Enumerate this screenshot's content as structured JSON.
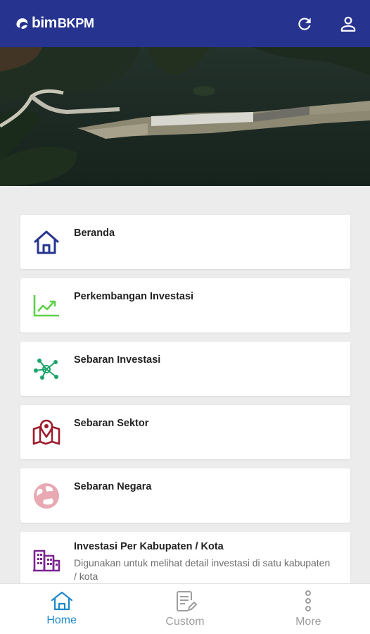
{
  "app": {
    "logo_bim": "bim",
    "logo_bkpm": "BKPM",
    "refresh_icon": "refresh-icon",
    "account_icon": "account-icon",
    "header_color": "#26348f"
  },
  "banner": {
    "image": "aerial-view-port-construction",
    "slide_count": 6,
    "active_slide": 2
  },
  "menu": {
    "items": [
      {
        "title": "Beranda",
        "icon": "home-icon",
        "icon_color": "#26348f"
      },
      {
        "title": "Perkembangan Investasi",
        "icon": "trending-chart-icon",
        "icon_color": "#5fd14a"
      },
      {
        "title": "Sebaran Investasi",
        "icon": "network-nodes-icon",
        "icon_color": "#1ba46a"
      },
      {
        "title": "Sebaran Sektor",
        "icon": "map-pin-icon",
        "icon_color": "#9c1c2a"
      },
      {
        "title": "Sebaran Negara",
        "icon": "globe-icon",
        "icon_color": "#e8a9b2"
      },
      {
        "title": "Investasi Per Kabupaten / Kota",
        "description": "Digunakan untuk melihat detail investasi di satu kabupaten / kota",
        "icon": "city-buildings-icon",
        "icon_color": "#7b2590"
      }
    ]
  },
  "bottom_nav": {
    "items": [
      {
        "label": "Home",
        "icon": "home-outline-icon",
        "active": true
      },
      {
        "label": "Custom",
        "icon": "document-edit-icon",
        "active": false
      },
      {
        "label": "More",
        "icon": "more-vertical-icon",
        "active": false
      }
    ],
    "active_color": "#1e88c7"
  }
}
